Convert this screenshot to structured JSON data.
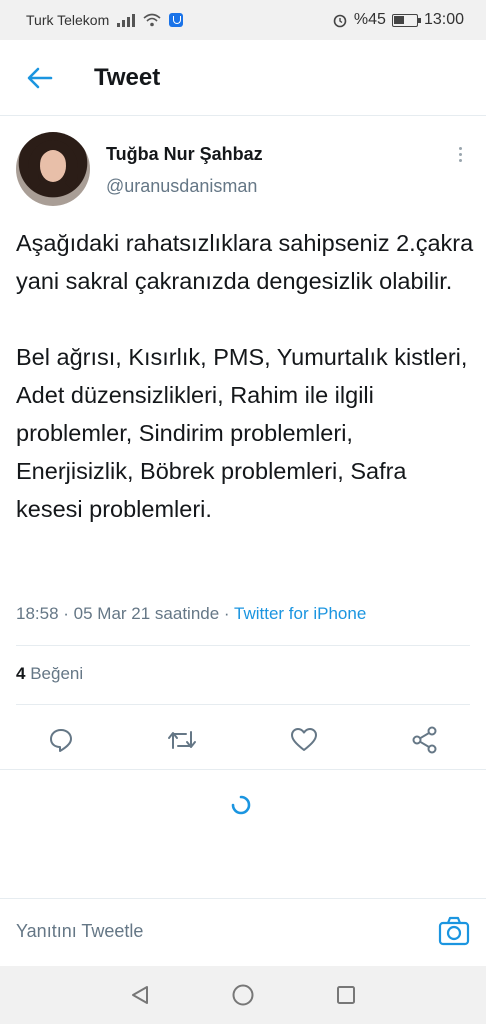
{
  "status_bar": {
    "carrier": "Turk Telekom",
    "battery_percent": "%45",
    "time": "13:00"
  },
  "header": {
    "title": "Tweet",
    "back_icon": "arrow-left-icon"
  },
  "tweet": {
    "author_name": "Tuğba Nur Şahbaz",
    "author_handle": "@uranusdanisman",
    "text": "Aşağıdaki rahatsızlıklara sahipseniz 2.çakra yani sakral çakranızda dengesizlik olabilir.\n\nBel ağrısı, Kısırlık, PMS, Yumurtalık kistleri, Adet düzensizlikleri, Rahim ile ilgili problemler, Sindirim problemleri, Enerjisizlik, Böbrek problemleri, Safra kesesi problemleri.",
    "meta_time": "18:58 · 05 Mar 21 saatinde · ",
    "meta_source": "Twitter for iPhone",
    "like_count": "4",
    "like_label": " Beğeni"
  },
  "reply_bar": {
    "placeholder": "Yanıtını Tweetle"
  },
  "colors": {
    "accent": "#1b95e0",
    "secondary_text": "#657786",
    "border": "#e6ecf0"
  }
}
